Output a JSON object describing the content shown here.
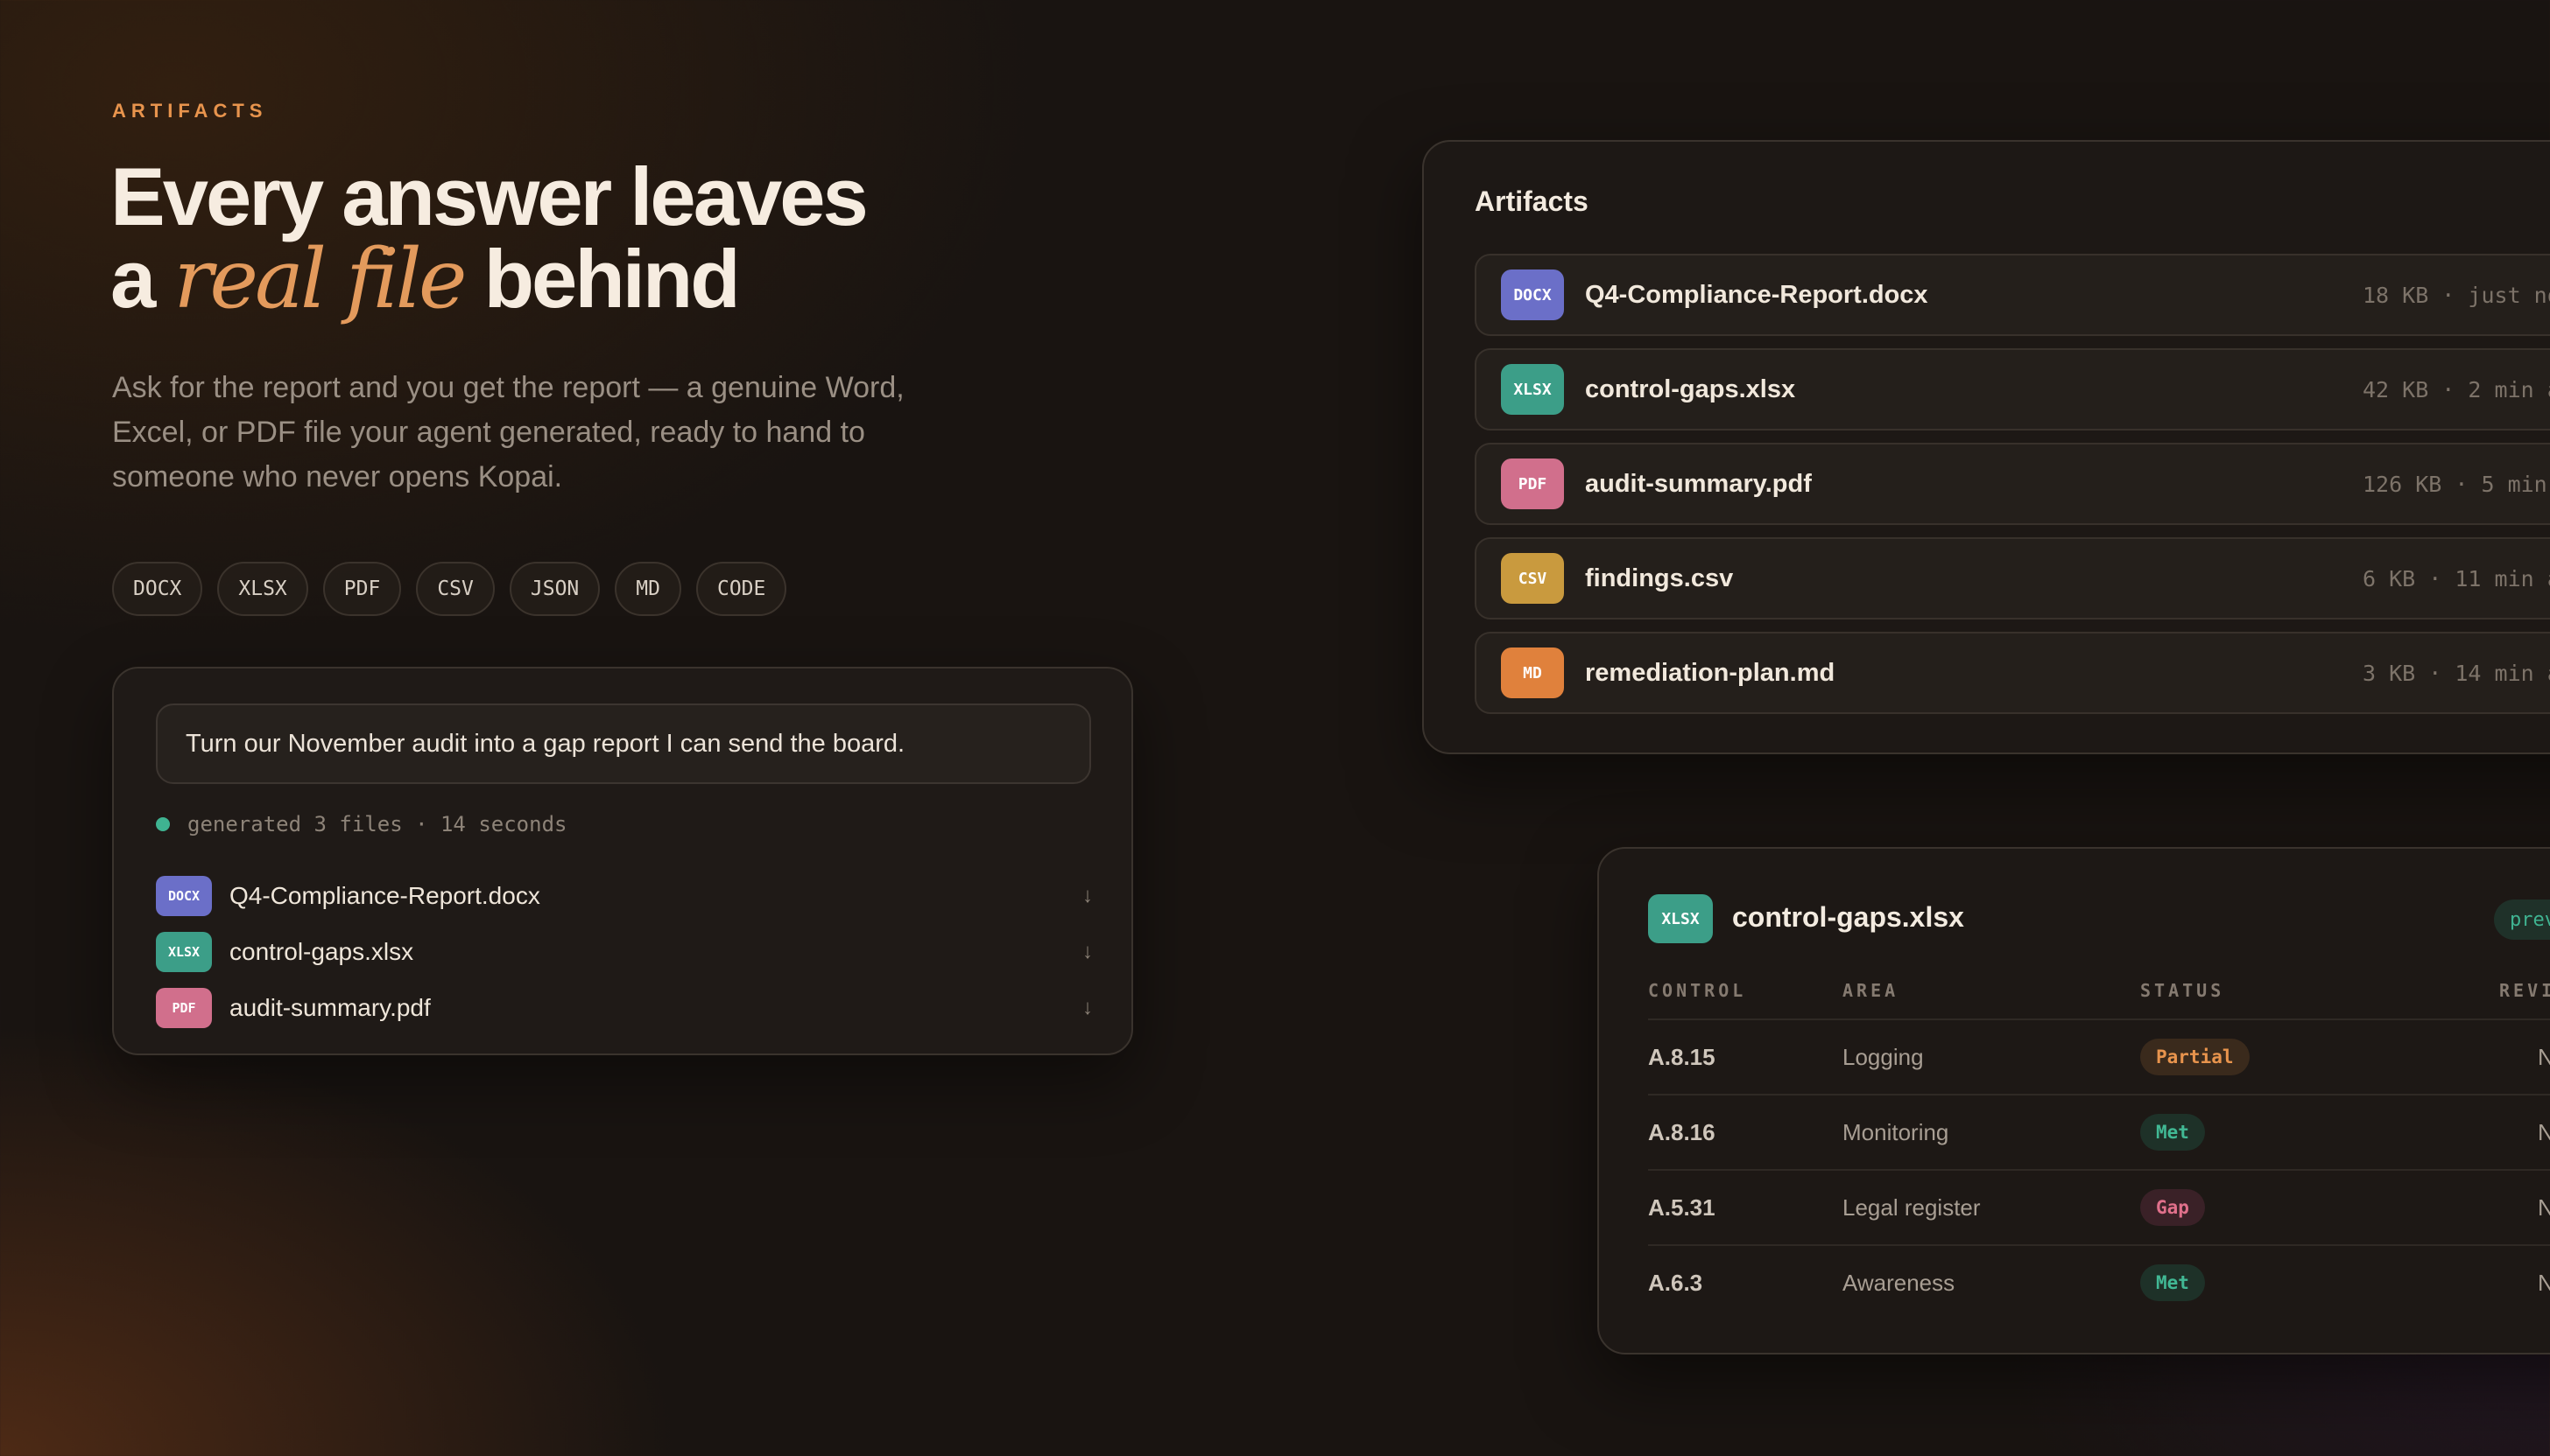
{
  "hero": {
    "eyebrow": "ARTIFACTS",
    "headline_line1": "Every answer leaves",
    "headline_a": "a",
    "headline_accent": "real file",
    "headline_end": "behind",
    "lede": "Ask for the report and you get the report — a genuine Word, Excel, or PDF file your agent generated, ready to hand to someone who never opens Kopai.",
    "formats": [
      "DOCX",
      "XLSX",
      "PDF",
      "CSV",
      "JSON",
      "MD",
      "CODE"
    ]
  },
  "chat": {
    "prompt": "Turn our November audit into a gap report I can send the board.",
    "generated": "generated 3 files · 14 seconds",
    "files": [
      {
        "type": "DOCX",
        "name": "Q4-Compliance-Report.docx",
        "color": "#6b6fc8"
      },
      {
        "type": "XLSX",
        "name": "control-gaps.xlsx",
        "color": "#3c9e88"
      },
      {
        "type": "PDF",
        "name": "audit-summary.pdf",
        "color": "#d16f8c"
      }
    ],
    "download_glyph": "↓"
  },
  "artifacts": {
    "title": "Artifacts",
    "items": [
      {
        "type": "DOCX",
        "name": "Q4-Compliance-Report.docx",
        "meta": "18 KB · just no",
        "color": "#6b6fc8"
      },
      {
        "type": "XLSX",
        "name": "control-gaps.xlsx",
        "meta": "42 KB · 2 min ag",
        "color": "#3c9e88"
      },
      {
        "type": "PDF",
        "name": "audit-summary.pdf",
        "meta": "126 KB · 5 min ag",
        "color": "#d16f8c"
      },
      {
        "type": "CSV",
        "name": "findings.csv",
        "meta": "6 KB · 11 min ag",
        "color": "#c99a3e"
      },
      {
        "type": "MD",
        "name": "remediation-plan.md",
        "meta": "3 KB · 14 min ag",
        "color": "#e0813c"
      }
    ]
  },
  "preview": {
    "type": "XLSX",
    "title": "control-gaps.xlsx",
    "pill": "prev",
    "headers": {
      "control": "CONTROL",
      "area": "AREA",
      "status": "STATUS",
      "review": "REVI"
    },
    "rows": [
      {
        "control": "A.8.15",
        "area": "Logging",
        "status": "Partial",
        "status_kind": "partial",
        "review": "N"
      },
      {
        "control": "A.8.16",
        "area": "Monitoring",
        "status": "Met",
        "status_kind": "met",
        "review": "N"
      },
      {
        "control": "A.5.31",
        "area": "Legal register",
        "status": "Gap",
        "status_kind": "gap",
        "review": "N"
      },
      {
        "control": "A.6.3",
        "area": "Awareness",
        "status": "Met",
        "status_kind": "met",
        "review": "N"
      }
    ]
  }
}
